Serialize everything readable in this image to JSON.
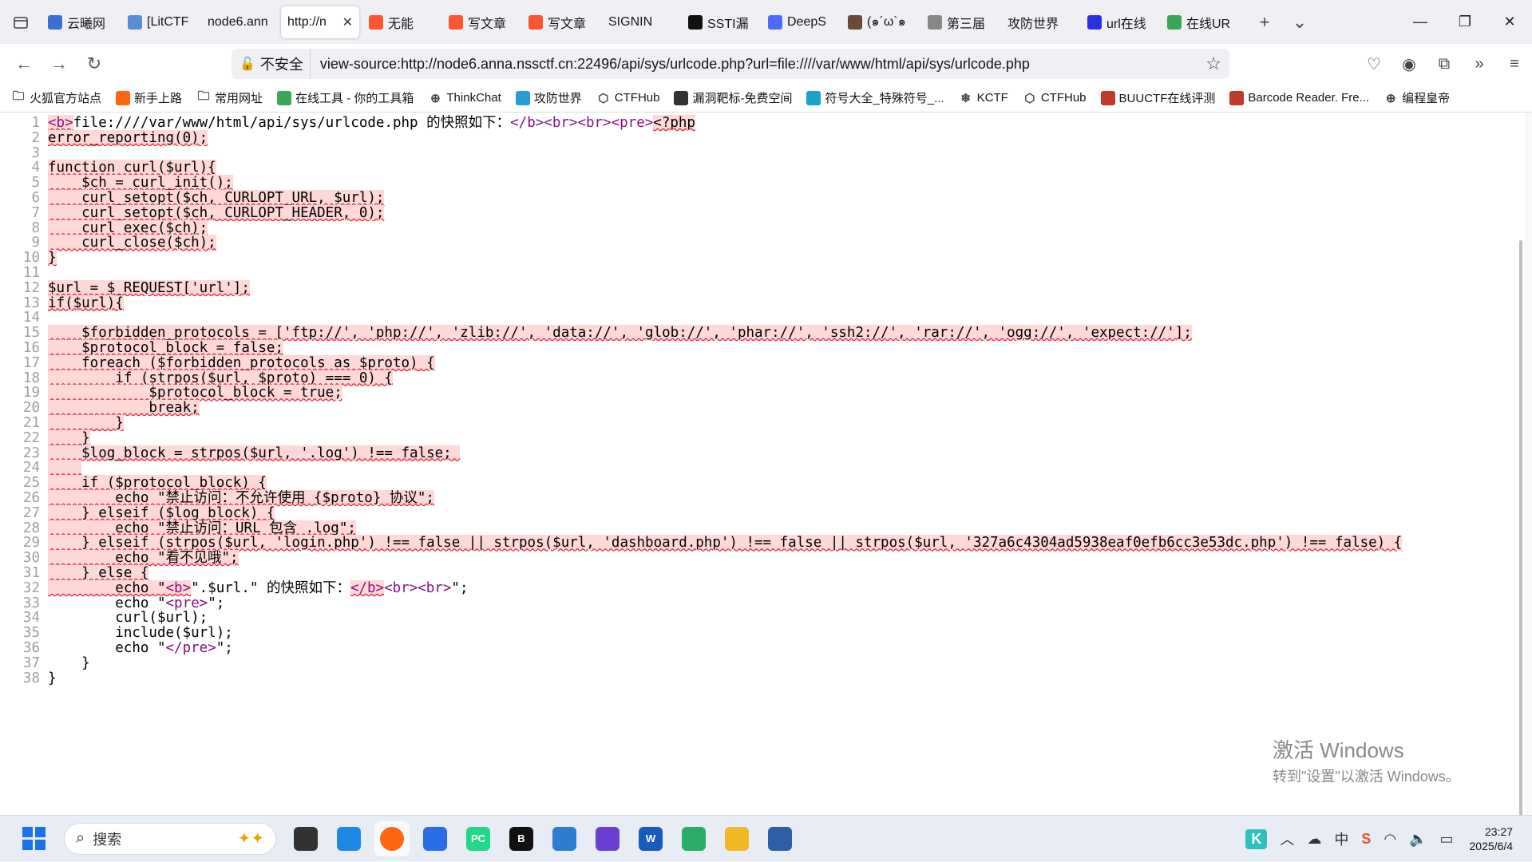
{
  "tabs": [
    {
      "label": "云曦网",
      "icon": "globe-icon",
      "color": "#3b6fd8",
      "active": false
    },
    {
      "label": "[LitCTF",
      "icon": "page-icon",
      "color": "#5a8dd6",
      "active": false
    },
    {
      "label": "node6.ann",
      "icon": "",
      "color": "",
      "active": false
    },
    {
      "label": "http://n",
      "icon": "",
      "color": "",
      "active": true
    },
    {
      "label": "无能",
      "icon": "csdn-icon",
      "color": "#fc5531",
      "active": false
    },
    {
      "label": "写文章",
      "icon": "csdn-icon",
      "color": "#fc5531",
      "active": false
    },
    {
      "label": "写文章",
      "icon": "csdn-icon",
      "color": "#fc5531",
      "active": false
    },
    {
      "label": "SIGNIN",
      "icon": "",
      "color": "",
      "active": false
    },
    {
      "label": "SSTI漏",
      "icon": "k-icon",
      "color": "#111111",
      "active": false
    },
    {
      "label": "DeepS",
      "icon": "deepseek-icon",
      "color": "#4d6bfe",
      "active": false
    },
    {
      "label": "(๑´ω`๑",
      "icon": "avatar-icon",
      "color": "#6b4a3a",
      "active": false
    },
    {
      "label": "第三届",
      "icon": "mic-icon",
      "color": "#888888",
      "active": false
    },
    {
      "label": "攻防世界",
      "icon": "",
      "color": "",
      "active": false
    },
    {
      "label": "url在线",
      "icon": "baidu-icon",
      "color": "#2932e1",
      "active": false
    },
    {
      "label": "在线UR",
      "icon": "tool-icon",
      "color": "#3aa657",
      "active": false
    }
  ],
  "urlbar": {
    "security_label": "不安全",
    "url": "view-source:http://node6.anna.nssctf.cn:22496/api/sys/urlcode.php?url=file:////var/www/html/api/sys/urlcode.php"
  },
  "bookmarks": [
    {
      "label": "火狐官方站点",
      "icon": "folder-icon"
    },
    {
      "label": "新手上路",
      "icon": "firefox-icon"
    },
    {
      "label": "常用网址",
      "icon": "folder-icon"
    },
    {
      "label": "在线工具 - 你的工具箱",
      "icon": "tool-icon"
    },
    {
      "label": "ThinkChat",
      "icon": "globe-icon"
    },
    {
      "label": "攻防世界",
      "icon": "swirl-icon"
    },
    {
      "label": "CTFHub",
      "icon": "cube-icon"
    },
    {
      "label": "漏洞靶标-免费空间",
      "icon": "target-icon"
    },
    {
      "label": "符号大全_特殊符号_...",
      "icon": "ke-icon"
    },
    {
      "label": "KCTF",
      "icon": "snowflake-icon"
    },
    {
      "label": "CTFHub",
      "icon": "cube-icon"
    },
    {
      "label": "BUUCTF在线评测",
      "icon": "buu-icon"
    },
    {
      "label": "Barcode Reader. Fre...",
      "icon": "barcode-icon"
    },
    {
      "label": "编程皇帝",
      "icon": "globe-icon"
    }
  ],
  "source_lines": [
    {
      "n": "1",
      "segs": [
        [
          "<b>",
          "tag err"
        ],
        [
          "file:////var/www/html/api/sys/urlcode.php 的快照如下：",
          ""
        ],
        [
          "</b>",
          "tag"
        ],
        [
          "<br>",
          "tag"
        ],
        [
          "<br>",
          "tag"
        ],
        [
          "<pre>",
          "tag"
        ],
        [
          "<?php",
          "err"
        ]
      ]
    },
    {
      "n": "2",
      "segs": [
        [
          "error_reporting(0);",
          "err"
        ]
      ]
    },
    {
      "n": "3",
      "segs": []
    },
    {
      "n": "4",
      "segs": [
        [
          "function curl($url){",
          "err"
        ]
      ]
    },
    {
      "n": "5",
      "segs": [
        [
          "    $ch = curl_init();",
          "err"
        ]
      ]
    },
    {
      "n": "6",
      "segs": [
        [
          "    curl_setopt($ch, CURLOPT_URL, $url);",
          "err"
        ]
      ]
    },
    {
      "n": "7",
      "segs": [
        [
          "    curl_setopt($ch, CURLOPT_HEADER, 0);",
          "err"
        ]
      ]
    },
    {
      "n": "8",
      "segs": [
        [
          "    curl_exec($ch);",
          "err"
        ]
      ]
    },
    {
      "n": "9",
      "segs": [
        [
          "    curl_close($ch);",
          "err"
        ]
      ]
    },
    {
      "n": "10",
      "segs": [
        [
          "}",
          "err"
        ]
      ]
    },
    {
      "n": "11",
      "segs": []
    },
    {
      "n": "12",
      "segs": [
        [
          "$url = $_REQUEST['url'];",
          "err"
        ]
      ]
    },
    {
      "n": "13",
      "segs": [
        [
          "if($url){",
          "err"
        ]
      ]
    },
    {
      "n": "14",
      "segs": []
    },
    {
      "n": "15",
      "segs": [
        [
          "    $forbidden_protocols = ['ftp://', 'php://', 'zlib://', 'data://', 'glob://', 'phar://', 'ssh2://', 'rar://', 'ogg://', 'expect://'];",
          "err"
        ]
      ]
    },
    {
      "n": "16",
      "segs": [
        [
          "    $protocol_block = false;",
          "err"
        ]
      ]
    },
    {
      "n": "17",
      "segs": [
        [
          "    foreach ($forbidden_protocols as $proto) {",
          "err"
        ]
      ]
    },
    {
      "n": "18",
      "segs": [
        [
          "        if (strpos($url, $proto) === 0) {",
          "err"
        ]
      ]
    },
    {
      "n": "19",
      "segs": [
        [
          "            $protocol_block = true;",
          "err"
        ]
      ]
    },
    {
      "n": "20",
      "segs": [
        [
          "            break;",
          "err"
        ]
      ]
    },
    {
      "n": "21",
      "segs": [
        [
          "        }",
          "err"
        ]
      ]
    },
    {
      "n": "22",
      "segs": [
        [
          "    }",
          "err"
        ]
      ]
    },
    {
      "n": "23",
      "segs": [
        [
          "    $log_block = strpos($url, '.log') !== false; ",
          "err"
        ]
      ]
    },
    {
      "n": "24",
      "segs": [
        [
          "    ",
          "err"
        ]
      ]
    },
    {
      "n": "25",
      "segs": [
        [
          "    if ($protocol_block) {",
          "err"
        ]
      ]
    },
    {
      "n": "26",
      "segs": [
        [
          "        echo \"禁止访问：不允许使用 {$proto} 协议\";",
          "err"
        ]
      ]
    },
    {
      "n": "27",
      "segs": [
        [
          "    } elseif ($log_block) {",
          "err"
        ]
      ]
    },
    {
      "n": "28",
      "segs": [
        [
          "        echo \"禁止访问：URL 包含 .log\";",
          "err"
        ]
      ]
    },
    {
      "n": "29",
      "segs": [
        [
          "    } elseif (strpos($url, 'login.php') !== false || strpos($url, 'dashboard.php') !== false || strpos($url, '327a6c4304ad5938eaf0efb6cc3e53dc.php') !== false) {",
          "err"
        ]
      ]
    },
    {
      "n": "30",
      "segs": [
        [
          "        echo \"看不见哦\";",
          "err"
        ]
      ]
    },
    {
      "n": "31",
      "segs": [
        [
          "    } else {",
          "err"
        ]
      ]
    },
    {
      "n": "32",
      "segs": [
        [
          "        echo \"",
          "err"
        ],
        [
          "<b>",
          "tag err"
        ],
        [
          "\".$url.\" 的快照如下：",
          ""
        ],
        [
          "</b>",
          "tag err"
        ],
        [
          "<br>",
          "tag"
        ],
        [
          "<br>",
          "tag"
        ],
        [
          "\";",
          ""
        ]
      ]
    },
    {
      "n": "33",
      "segs": [
        [
          "        echo \"",
          ""
        ],
        [
          "<pre>",
          "tag"
        ],
        [
          "\";",
          ""
        ]
      ]
    },
    {
      "n": "34",
      "segs": [
        [
          "        curl($url);",
          ""
        ]
      ]
    },
    {
      "n": "35",
      "segs": [
        [
          "        include($url);",
          ""
        ]
      ]
    },
    {
      "n": "36",
      "segs": [
        [
          "        echo \"",
          ""
        ],
        [
          "</pre>",
          "tag"
        ],
        [
          "\";",
          ""
        ]
      ]
    },
    {
      "n": "37",
      "segs": [
        [
          "    }",
          ""
        ]
      ]
    },
    {
      "n": "38",
      "segs": [
        [
          "}",
          ""
        ]
      ]
    }
  ],
  "watermark": {
    "title": "激活 Windows",
    "subtitle": "转到\"设置\"以激活 Windows。"
  },
  "taskbar": {
    "search_placeholder": "搜索",
    "apps": [
      {
        "name": "task-view",
        "label": "",
        "color": "#333333"
      },
      {
        "name": "app-blue",
        "label": "",
        "color": "#1e88e5"
      },
      {
        "name": "firefox",
        "label": "",
        "color": "#ff6611"
      },
      {
        "name": "app-k",
        "label": "",
        "color": "#2b6de6"
      },
      {
        "name": "pycharm",
        "label": "PC",
        "color": "#21d789"
      },
      {
        "name": "burp",
        "label": "B",
        "color": "#111111"
      },
      {
        "name": "notepad",
        "label": "",
        "color": "#2d7dd2"
      },
      {
        "name": "app-bolt",
        "label": "",
        "color": "#6b3fd4"
      },
      {
        "name": "word",
        "label": "W",
        "color": "#185abd"
      },
      {
        "name": "wechat",
        "label": "",
        "color": "#2aae67"
      },
      {
        "name": "explorer",
        "label": "",
        "color": "#f2b824"
      },
      {
        "name": "app-lock",
        "label": "",
        "color": "#2f5ea8"
      }
    ],
    "tray_k": "K",
    "ime": "中",
    "time": "23:27",
    "date": "2025/6/4"
  }
}
